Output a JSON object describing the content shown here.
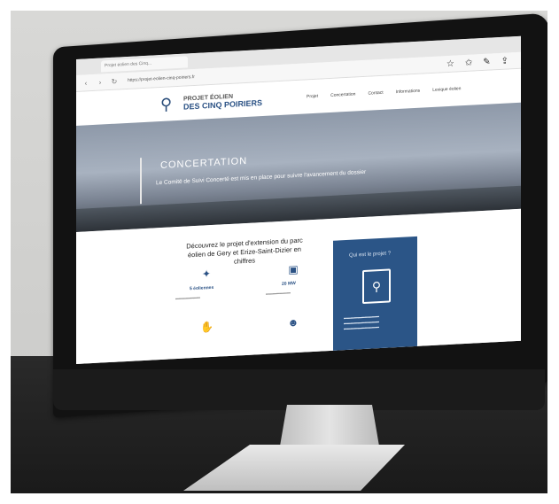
{
  "browser": {
    "tab_label": "Projet éolien des Cinq...",
    "url": "https://projet-eolien-cinq-poiriers.fr",
    "back": "‹",
    "forward": "›",
    "refresh": "↻",
    "icons": [
      "star-icon",
      "favorites-icon",
      "pen-icon",
      "share-icon"
    ]
  },
  "site": {
    "logo_top": "PROJET ÉOLIEN",
    "logo_bottom": "DES CINQ POIRIERS",
    "nav": [
      "Projet",
      "Concertation",
      "Contact",
      "Informations",
      "Lexique éolien"
    ]
  },
  "hero": {
    "title": "CONCERTATION",
    "subtitle": "Le Comité de Suivi Concerté est mis en place pour suivre l'avancement du dossier"
  },
  "content": {
    "section_title": "Découvrez le projet d'extension du parc éolien de Gery et Erize-Saint-Dizier en chiffres",
    "feature_1_label": "5 éoliennes",
    "feature_2_label": "20 MW",
    "card_title": "Qui est le projet ?"
  },
  "colors": {
    "brand": "#2b5285",
    "card": "#2b5587"
  }
}
